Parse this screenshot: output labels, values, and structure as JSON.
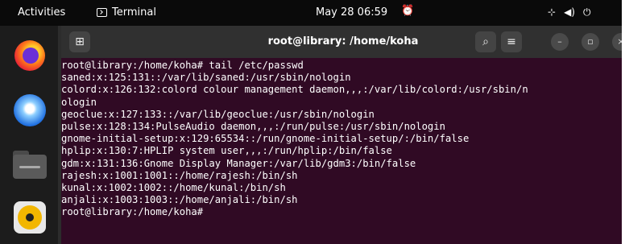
{
  "topbar": {
    "activities": "Activities",
    "app_name": "Terminal",
    "clock": "May 28  06:59",
    "tray_network": "⊹",
    "tray_volume": "◀)",
    "tray_power": "⏻"
  },
  "dock": {
    "apps": [
      "firefox-icon",
      "thunderbird-icon",
      "files-icon",
      "rhythmbox-icon"
    ]
  },
  "window": {
    "title": "root@library: /home/koha",
    "newtab_glyph": "⊞",
    "search_glyph": "⌕",
    "menu_glyph": "≡",
    "min_glyph": "–",
    "max_glyph": "▫",
    "close_glyph": "×"
  },
  "terminal": {
    "lines": [
      "root@library:/home/koha# tail /etc/passwd",
      "saned:x:125:131::/var/lib/saned:/usr/sbin/nologin",
      "colord:x:126:132:colord colour management daemon,,,:/var/lib/colord:/usr/sbin/n",
      "ologin",
      "geoclue:x:127:133::/var/lib/geoclue:/usr/sbin/nologin",
      "pulse:x:128:134:PulseAudio daemon,,,:/run/pulse:/usr/sbin/nologin",
      "gnome-initial-setup:x:129:65534::/run/gnome-initial-setup/:/bin/false",
      "hplip:x:130:7:HPLIP system user,,,:/run/hplip:/bin/false",
      "gdm:x:131:136:Gnome Display Manager:/var/lib/gdm3:/bin/false",
      "rajesh:x:1001:1001::/home/rajesh:/bin/sh",
      "kunal:x:1002:1002::/home/kunal:/bin/sh",
      "anjali:x:1003:1003::/home/anjali:/bin/sh",
      "root@library:/home/koha#"
    ]
  }
}
